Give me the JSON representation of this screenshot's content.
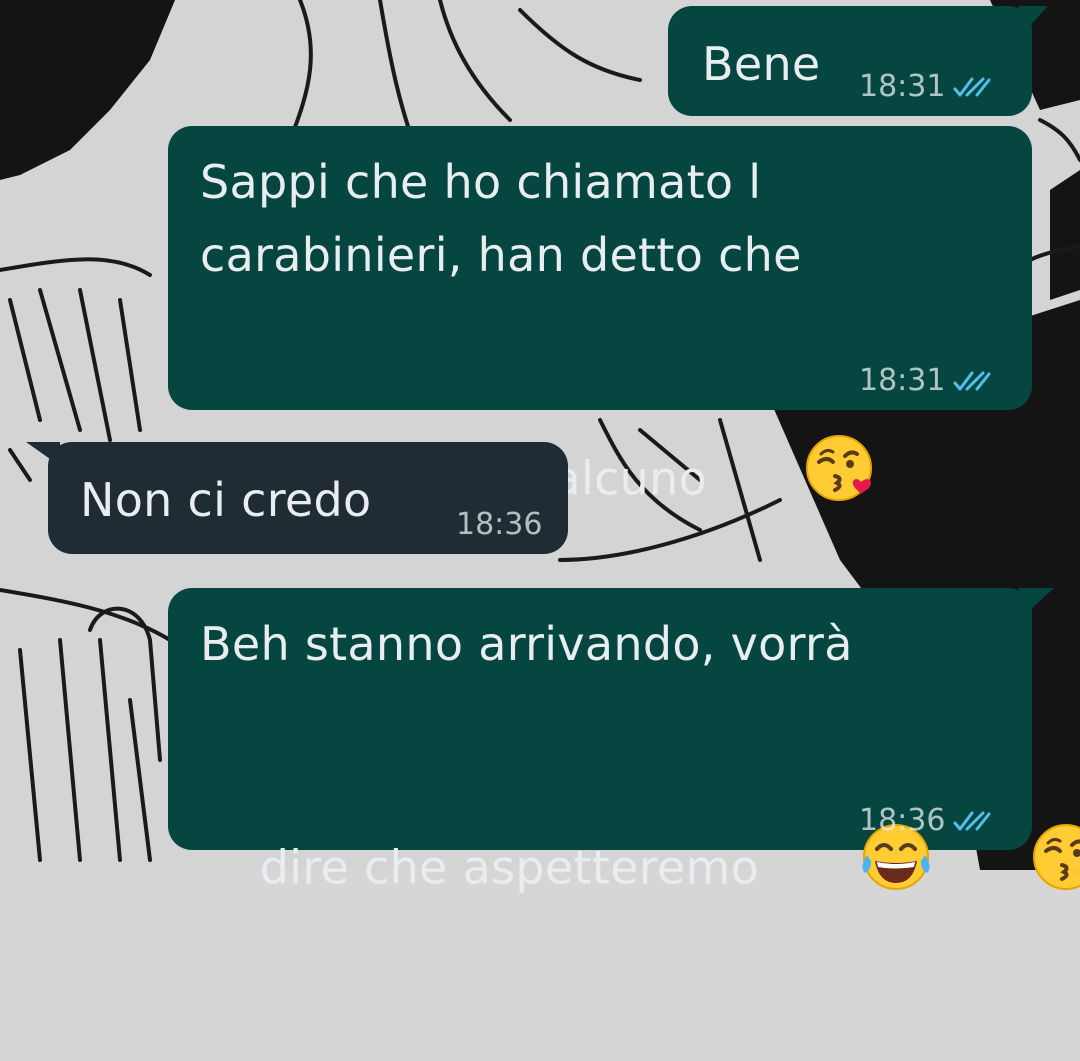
{
  "chat": {
    "accent_outgoing": "#054740",
    "accent_incoming": "#1f2c34",
    "read_tick_color": "#53bdeb",
    "messages": [
      {
        "direction": "outgoing",
        "text": "Bene",
        "time": "18:31",
        "status": "read"
      },
      {
        "direction": "outgoing",
        "line1": "Sappi che ho chiamato l",
        "line2": "carabinieri, han detto che",
        "line3": "mandano qualcuno",
        "emoji": "face-blowing-a-kiss",
        "time": "18:31",
        "status": "read"
      },
      {
        "direction": "incoming",
        "text": "Non ci credo",
        "time": "18:36"
      },
      {
        "direction": "outgoing",
        "line1": "Beh stanno arrivando, vorrà",
        "line2": "dire che aspetteremo",
        "emojis": [
          "face-with-tears-of-joy",
          "face-blowing-a-kiss"
        ],
        "time": "18:36",
        "status": "read"
      }
    ]
  }
}
